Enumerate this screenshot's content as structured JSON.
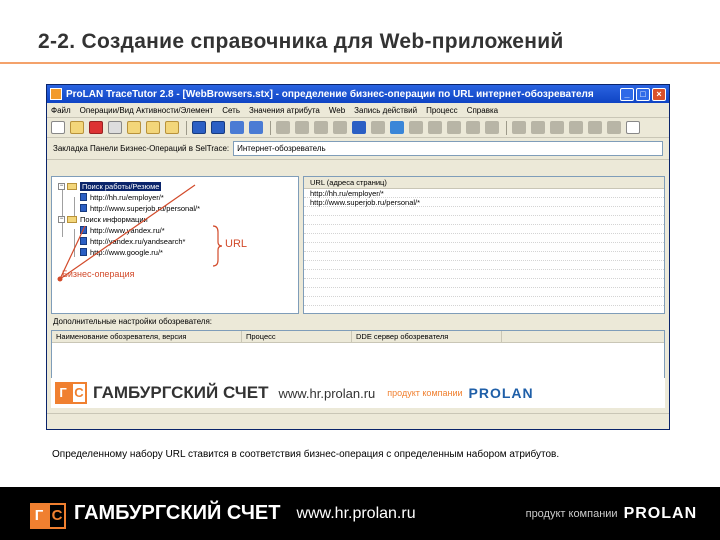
{
  "slide": {
    "title": "2-2. Создание справочника для Web-приложений",
    "caption": "Определенному набору URL ставится в соответствия бизнес-операция с определенным набором атрибутов."
  },
  "window": {
    "title": "ProLAN TraceTutor 2.8 - [WebBrowsers.stx] - определение бизнес-операции по URL интернет-обозревателя",
    "buttons": {
      "minimize": "_",
      "maximize": "□",
      "close": "×"
    }
  },
  "menu": [
    "Файл",
    "Операции/Вид Активности/Элемент",
    "Сеть",
    "Значения атрибута",
    "Web",
    "Запись действий",
    "Процесс",
    "Справка"
  ],
  "pathbar": {
    "label": "Закладка Панели Бизнес-Операций в SelTrace:",
    "value": "Интернет-обозреватель"
  },
  "tree": {
    "folder1": "Поиск работы/Резюме",
    "folder1_items": [
      "http://hh.ru/employer/*",
      "http://www.superjob.ru/personal/*"
    ],
    "folder2": "Поиск информации",
    "folder2_items": [
      "http://www.yandex.ru/*",
      "http://yandex.ru/yandsearch*",
      "http://www.google.ru/*"
    ]
  },
  "list": {
    "header": "URL (адреса страниц)",
    "rows": [
      "http://hh.ru/employer/*",
      "http://www.superjob.ru/personal/*"
    ]
  },
  "attrs": {
    "label": "Дополнительные настройки обозревателя:",
    "columns": [
      "Наименование обозревателя, версия",
      "Процесс",
      "DDE сервер обозревателя"
    ]
  },
  "annotations": {
    "url": "URL",
    "operation": "Бизнес-операция"
  },
  "brand": {
    "g": "Г",
    "c": "С",
    "name": "ГАМБУРГСКИЙ СЧЕТ",
    "url": "www.hr.prolan.ru",
    "product": "продукт компании",
    "company": "PROLAN"
  },
  "colors": {
    "accent": "#f08030",
    "rule": "#f4a26b",
    "annotation": "#d24a2a",
    "xp_title": "#0f44c4"
  }
}
